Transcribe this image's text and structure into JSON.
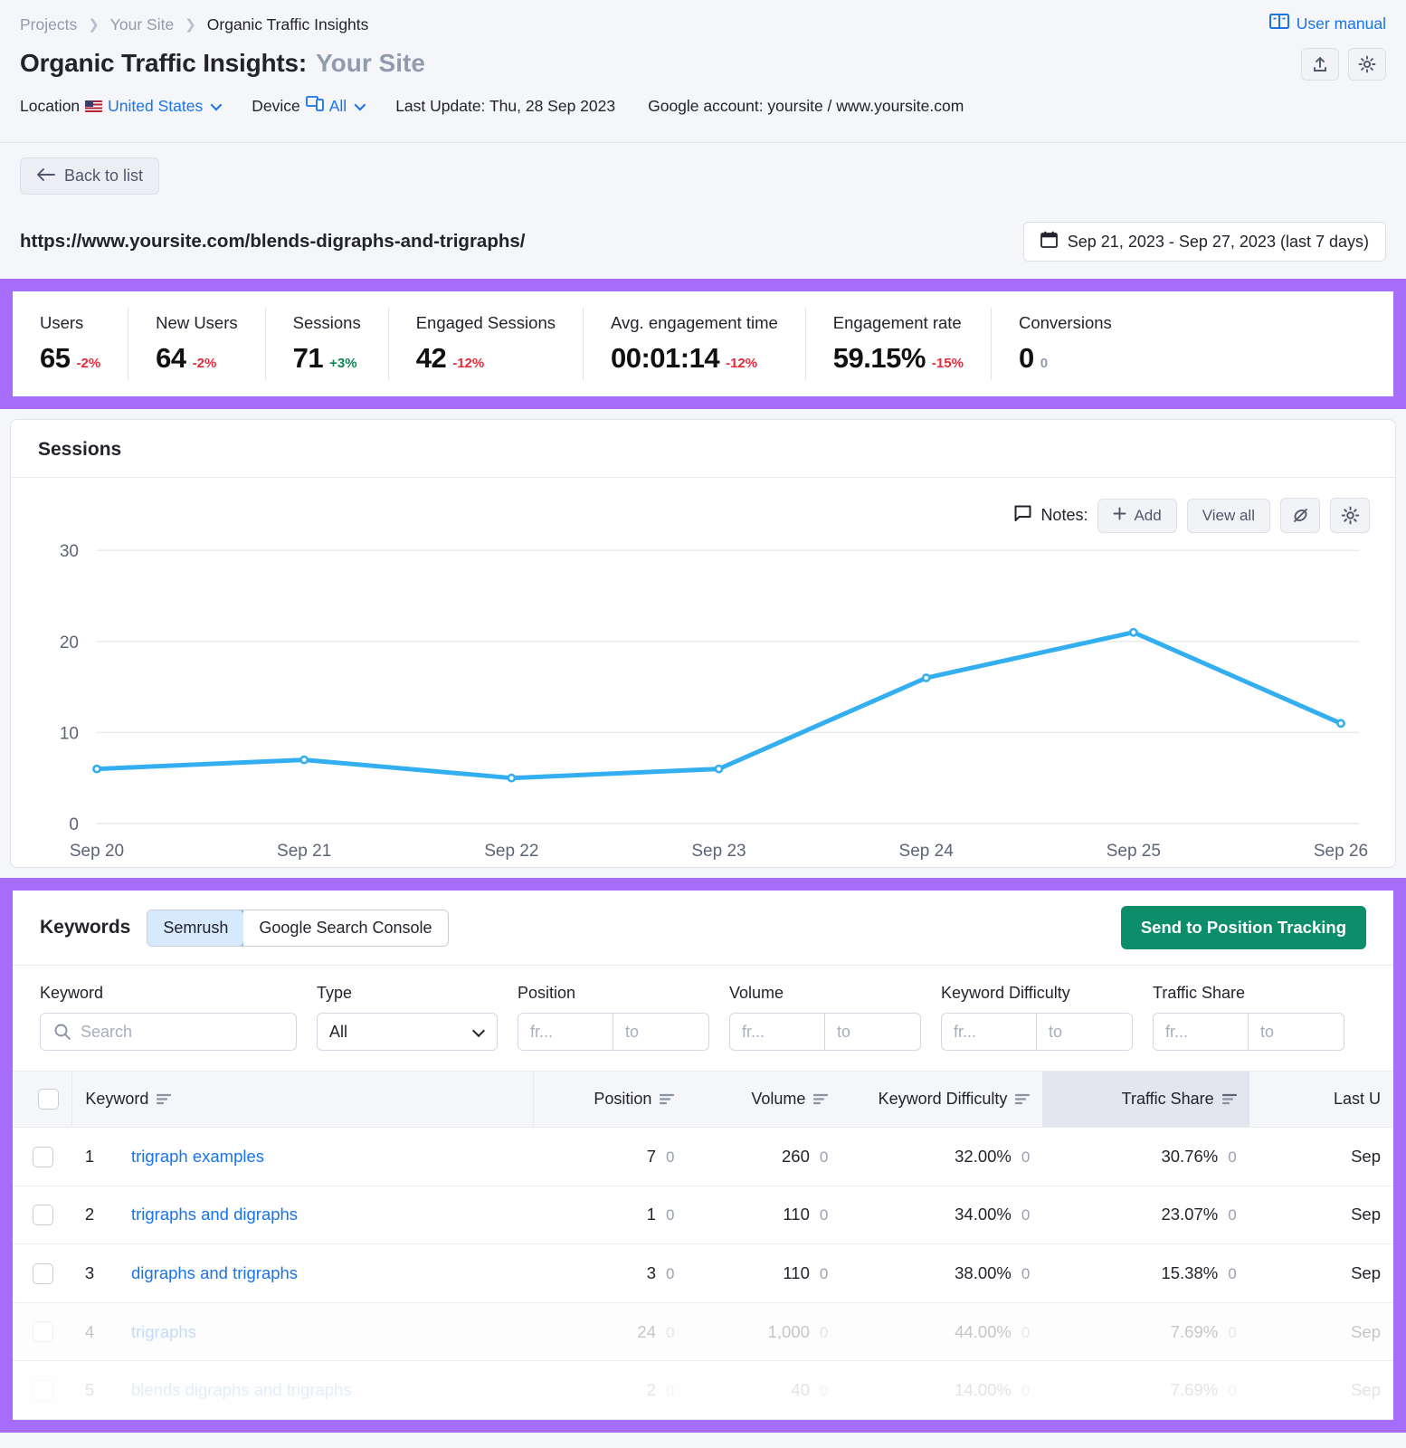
{
  "header": {
    "breadcrumb": [
      "Projects",
      "Your Site",
      "Organic Traffic Insights"
    ],
    "title": "Organic Traffic Insights:",
    "title_site": "Your Site",
    "user_manual": "User manual",
    "meta": {
      "location_label": "Location",
      "location_value": "United States",
      "device_label": "Device",
      "device_value": "All",
      "last_update": "Last Update: Thu, 28 Sep 2023",
      "google_account": "Google account: yoursite / www.yoursite.com"
    },
    "icons": {
      "export": "upload-icon",
      "settings": "gear-icon"
    }
  },
  "subheader": {
    "back_label": "Back to list",
    "page_url": "https://www.yoursite.com/blends-digraphs-and-trigraphs/",
    "date_range": "Sep 21, 2023 - Sep 27, 2023 (last 7 days)"
  },
  "metrics": [
    {
      "label": "Users",
      "value": "65",
      "delta": "-2%",
      "trend": "neg"
    },
    {
      "label": "New Users",
      "value": "64",
      "delta": "-2%",
      "trend": "neg"
    },
    {
      "label": "Sessions",
      "value": "71",
      "delta": "+3%",
      "trend": "pos"
    },
    {
      "label": "Engaged Sessions",
      "value": "42",
      "delta": "-12%",
      "trend": "neg"
    },
    {
      "label": "Avg. engagement time",
      "value": "00:01:14",
      "delta": "-12%",
      "trend": "neg"
    },
    {
      "label": "Engagement rate",
      "value": "59.15%",
      "delta": "-15%",
      "trend": "neg"
    },
    {
      "label": "Conversions",
      "value": "0",
      "delta": "0",
      "trend": "zero"
    }
  ],
  "sessions_card": {
    "title": "Sessions",
    "notes_label": "Notes:",
    "add_label": "Add",
    "view_all_label": "View all",
    "hide_icon": "eye-off-icon",
    "settings_icon": "gear-icon"
  },
  "chart_data": {
    "type": "line",
    "title": "Sessions",
    "categories": [
      "Sep 20",
      "Sep 21",
      "Sep 22",
      "Sep 23",
      "Sep 24",
      "Sep 25",
      "Sep 26"
    ],
    "series": [
      {
        "name": "Sessions",
        "values": [
          6,
          7,
          5,
          6,
          16,
          21,
          11
        ],
        "color": "#33AEF0"
      }
    ],
    "yticks": [
      0,
      10,
      20,
      30
    ],
    "ylim": [
      0,
      33
    ],
    "xlabel": "",
    "ylabel": "",
    "grid": true,
    "legend": "none"
  },
  "keywords": {
    "title": "Keywords",
    "tabs": [
      {
        "label": "Semrush",
        "active": true
      },
      {
        "label": "Google Search Console",
        "active": false
      }
    ],
    "send_button": "Send to Position Tracking",
    "filters": {
      "keyword_label": "Keyword",
      "keyword_placeholder": "Search",
      "type_label": "Type",
      "type_value": "All",
      "type_options": [
        "All"
      ],
      "position_label": "Position",
      "volume_label": "Volume",
      "difficulty_label": "Keyword Difficulty",
      "traffic_share_label": "Traffic Share",
      "from_placeholder": "fr...",
      "to_placeholder": "to"
    },
    "columns": [
      {
        "key": "keyword",
        "label": "Keyword",
        "sortable": true
      },
      {
        "key": "position",
        "label": "Position",
        "sortable": true
      },
      {
        "key": "volume",
        "label": "Volume",
        "sortable": true
      },
      {
        "key": "difficulty",
        "label": "Keyword Difficulty",
        "sortable": true
      },
      {
        "key": "traffic_share",
        "label": "Traffic Share",
        "sortable": true,
        "sorted": true
      },
      {
        "key": "last_update",
        "label": "Last U",
        "sortable": false
      }
    ],
    "rows": [
      {
        "num": "1",
        "keyword": "trigraph examples",
        "position": "7",
        "position_d": "0",
        "volume": "260",
        "volume_d": "0",
        "difficulty": "32.00%",
        "difficulty_d": "0",
        "traffic_share": "30.76%",
        "traffic_share_d": "0",
        "last_update": "Sep",
        "state": "normal"
      },
      {
        "num": "2",
        "keyword": "trigraphs and digraphs",
        "position": "1",
        "position_d": "0",
        "volume": "110",
        "volume_d": "0",
        "difficulty": "34.00%",
        "difficulty_d": "0",
        "traffic_share": "23.07%",
        "traffic_share_d": "0",
        "last_update": "Sep",
        "state": "normal"
      },
      {
        "num": "3",
        "keyword": "digraphs and trigraphs",
        "position": "3",
        "position_d": "0",
        "volume": "110",
        "volume_d": "0",
        "difficulty": "38.00%",
        "difficulty_d": "0",
        "traffic_share": "15.38%",
        "traffic_share_d": "0",
        "last_update": "Sep",
        "state": "normal"
      },
      {
        "num": "4",
        "keyword": "trigraphs",
        "position": "24",
        "position_d": "0",
        "volume": "1,000",
        "volume_d": "0",
        "difficulty": "44.00%",
        "difficulty_d": "0",
        "traffic_share": "7.69%",
        "traffic_share_d": "0",
        "last_update": "Sep",
        "state": "faded"
      },
      {
        "num": "5",
        "keyword": "blends digraphs and trigraphs",
        "position": "2",
        "position_d": "0",
        "volume": "40",
        "volume_d": "0",
        "difficulty": "14.00%",
        "difficulty_d": "0",
        "traffic_share": "7.69%",
        "traffic_share_d": "0",
        "last_update": "Sep",
        "state": "faded2"
      }
    ]
  },
  "colors": {
    "accent_blue": "#1a73e8",
    "highlight_purple": "#a66cfa",
    "chart_line": "#33AEF0",
    "green_button": "#0c8e6b",
    "negative": "#e02d3c",
    "positive": "#0f8554"
  }
}
